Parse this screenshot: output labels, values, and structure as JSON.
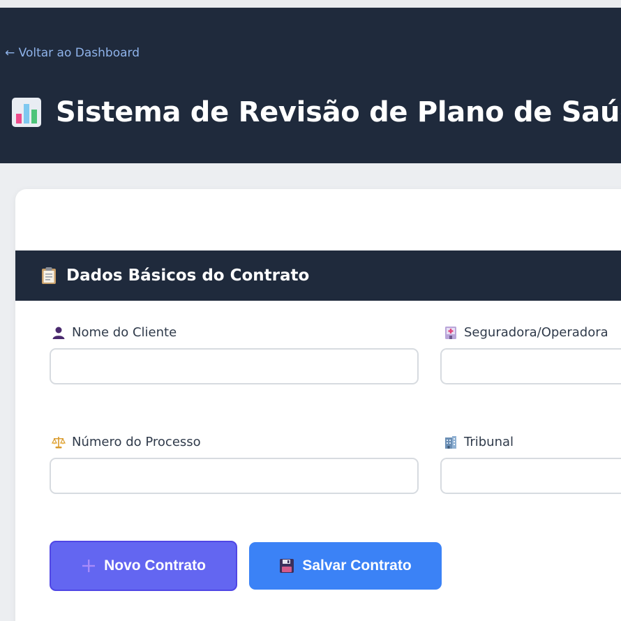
{
  "header": {
    "back_link": "← Voltar ao Dashboard",
    "title": "Sistema de Revisão de Plano de Saúde",
    "title_icon": "bar-chart-icon",
    "background": "#1f2a3c",
    "link_color": "#8fb3ea"
  },
  "section": {
    "title": "Dados Básicos do Contrato",
    "icon": "clipboard-icon"
  },
  "form": {
    "client_name": {
      "label": "Nome do Cliente",
      "icon": "person-icon",
      "value": "",
      "placeholder": ""
    },
    "insurer": {
      "label": "Seguradora/Operadora",
      "icon": "hospital-icon",
      "value": "",
      "placeholder": ""
    },
    "process_number": {
      "label": "Número do Processo",
      "icon": "scales-icon",
      "value": "",
      "placeholder": ""
    },
    "court": {
      "label": "Tribunal",
      "icon": "building-icon",
      "value": "",
      "placeholder": ""
    }
  },
  "buttons": {
    "new_contract": {
      "label": "Novo Contrato",
      "icon": "plus-icon",
      "color": "#6366f1"
    },
    "save_contract": {
      "label": "Salvar Contrato",
      "icon": "floppy-disk-icon",
      "color": "#3b82f6"
    }
  }
}
